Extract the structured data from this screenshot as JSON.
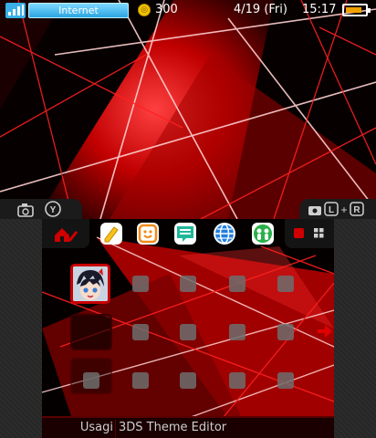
{
  "status_bar": {
    "network_label": "Internet",
    "coins": "300",
    "date": "4/19 (Fri)",
    "time": "15:17",
    "battery_level": 0.85,
    "battery_color": "#f2a200"
  },
  "top_screen": {
    "left_tab_icons": [
      "camera-icon",
      "y-button-icon"
    ],
    "right_tab_icons": [
      "camera-icon",
      "l-button-icon",
      "r-button-icon"
    ]
  },
  "app_bar": {
    "icons": [
      "settings-icon",
      "notes-icon",
      "miiverse-icon",
      "notifications-icon",
      "browser-icon",
      "friends-icon"
    ]
  },
  "view_controls": {
    "icons": [
      "single-view-icon",
      "grid-view-icon"
    ]
  },
  "home_grid": {
    "folder_tile_icon": "character-avatar-icon",
    "empty_tiles": 2
  },
  "name_bar": {
    "left": "Usagi",
    "right": "3DS Theme Editor"
  },
  "colors": {
    "accent": "#c80000",
    "background": "#0a0000"
  }
}
